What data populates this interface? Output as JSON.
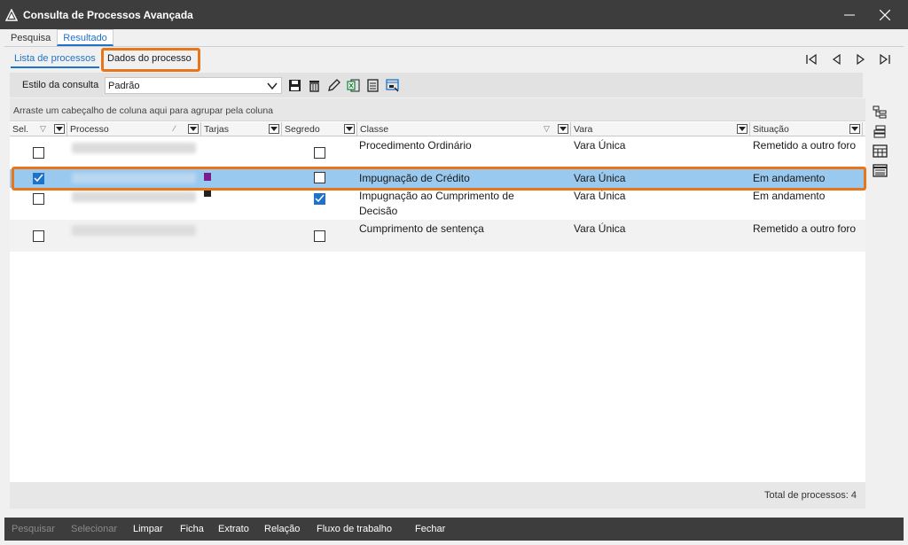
{
  "window": {
    "title": "Consulta de Processos Avançada"
  },
  "outer_tabs": [
    "Pesquisa",
    "Resultado"
  ],
  "inner_tabs": [
    "Lista de processos",
    "Dados do processo"
  ],
  "consulta": {
    "label": "Estilo da consulta",
    "value": "Padrão"
  },
  "group_hint": "Arraste um cabeçalho de coluna aqui para agrupar pela coluna",
  "columns": [
    "Sel.",
    "Processo",
    "Tarjas",
    "Segredo",
    "Classe",
    "Vara",
    "Situação"
  ],
  "rows": [
    {
      "sel": false,
      "segredo": false,
      "classe": "Procedimento Ordinário",
      "vara": "Vara Única",
      "situacao": "Remetido a outro foro",
      "tarja": ""
    },
    {
      "sel": true,
      "segredo": false,
      "classe": "Impugnação de Crédito",
      "vara": "Vara Única",
      "situacao": "Em andamento",
      "tarja": "#7b1d8a"
    },
    {
      "sel": false,
      "segredo": true,
      "classe": "Impugnação ao Cumprimento de Decisão",
      "vara": "Vara Única",
      "situacao": "Em andamento",
      "tarja": "#222222"
    },
    {
      "sel": false,
      "segredo": false,
      "classe": "Cumprimento de sentença",
      "vara": "Vara Única",
      "situacao": "Remetido a outro foro",
      "tarja": ""
    }
  ],
  "total": "Total de processos: 4",
  "buttons": [
    "Pesquisar",
    "Selecionar",
    "Limpar",
    "Ficha",
    "Extrato",
    "Relação",
    "Fluxo de trabalho",
    "Fechar"
  ],
  "colors": {
    "accent": "#1e73c8",
    "highlight": "#e8751a",
    "selected_row": "#99c9ef",
    "titlebar": "#3d3d3d"
  }
}
